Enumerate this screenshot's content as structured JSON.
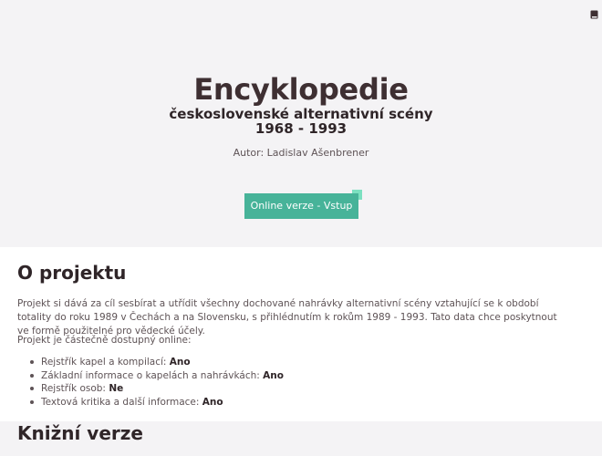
{
  "colors": {
    "hero_bg": "#f4f3f5",
    "accent": "#47b399",
    "text_dark": "#2f2528",
    "text_muted": "#5e5356"
  },
  "header": {
    "icon": "book-icon"
  },
  "hero": {
    "title": "Encyklopedie",
    "subtitle": "československé alternativní scény",
    "years": "1968 - 1993",
    "author": "Autor: Ladislav Ašenbrener",
    "button_label": "Online verze - Vstup"
  },
  "about": {
    "heading": "O projektu",
    "paragraph1": "Projekt si dává za cíl sesbírat a utřídit všechny dochované nahrávky alternativní scény vztahující se k období totality do roku 1989 v Čechách a na Slovensku, s přihlédnutím k rokům 1989 - 1993. Tato data chce poskytnout ve formě použitelné pro vědecké účely.",
    "paragraph2": "Projekt je částečně dostupný online:",
    "features": [
      {
        "label": "Rejstřík kapel a kompilací:",
        "value": "Ano"
      },
      {
        "label": "Základní informace o kapelách a nahrávkách:",
        "value": "Ano"
      },
      {
        "label": "Rejstřík osob:",
        "value": "Ne"
      },
      {
        "label": "Textová kritika a další informace:",
        "value": "Ano"
      }
    ]
  },
  "book": {
    "heading": "Knižní verze"
  }
}
